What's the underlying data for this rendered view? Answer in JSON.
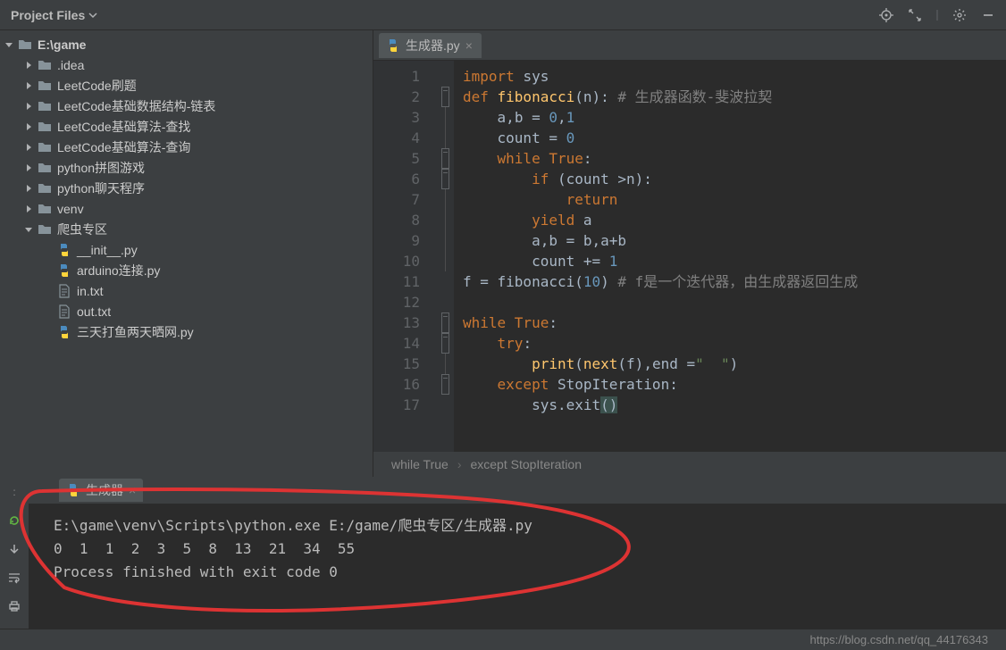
{
  "toolbar": {
    "project_label": "Project Files"
  },
  "project_tree": {
    "root": "E:\\game",
    "items": [
      {
        "type": "folder",
        "label": ".idea",
        "depth": 1,
        "caret": "right"
      },
      {
        "type": "folder",
        "label": "LeetCode刷题",
        "depth": 1,
        "caret": "right"
      },
      {
        "type": "folder",
        "label": "LeetCode基础数据结构-链表",
        "depth": 1,
        "caret": "right"
      },
      {
        "type": "folder",
        "label": "LeetCode基础算法-查找",
        "depth": 1,
        "caret": "right"
      },
      {
        "type": "folder",
        "label": "LeetCode基础算法-查询",
        "depth": 1,
        "caret": "right"
      },
      {
        "type": "folder",
        "label": "python拼图游戏",
        "depth": 1,
        "caret": "right"
      },
      {
        "type": "folder",
        "label": "python聊天程序",
        "depth": 1,
        "caret": "right"
      },
      {
        "type": "folder-alt",
        "label": "venv",
        "depth": 1,
        "caret": "right"
      },
      {
        "type": "folder",
        "label": "爬虫专区",
        "depth": 1,
        "caret": "down"
      },
      {
        "type": "python",
        "label": "__init__.py",
        "depth": 2,
        "caret": "none"
      },
      {
        "type": "python",
        "label": "arduino连接.py",
        "depth": 2,
        "caret": "none"
      },
      {
        "type": "txt",
        "label": "in.txt",
        "depth": 2,
        "caret": "none"
      },
      {
        "type": "txt",
        "label": "out.txt",
        "depth": 2,
        "caret": "none"
      },
      {
        "type": "python",
        "label": "三天打鱼两天晒网.py",
        "depth": 2,
        "caret": "none"
      }
    ]
  },
  "editor": {
    "tab_label": "生成器.py",
    "breadcrumb": [
      "while True",
      "except StopIteration"
    ],
    "lines": [
      {
        "n": 1,
        "fold": "",
        "code": "<span class='kw'>import </span>sys"
      },
      {
        "n": 2,
        "fold": "minus",
        "code": "<span class='kw'>def </span><span class='fn'>fibonacci</span>(n): <span class='cmt'># 生成器函数-斐波拉契</span>"
      },
      {
        "n": 3,
        "fold": "line",
        "code": "    a<span class='op'>,</span>b = <span class='num'>0</span><span class='op'>,</span><span class='num'>1</span>"
      },
      {
        "n": 4,
        "fold": "line",
        "code": "    count = <span class='num'>0</span>"
      },
      {
        "n": 5,
        "fold": "minus",
        "code": "    <span class='kw'>while True</span>:"
      },
      {
        "n": 6,
        "fold": "minus",
        "code": "        <span class='kw'>if </span>(count &gt;n):"
      },
      {
        "n": 7,
        "fold": "line",
        "code": "            <span class='kw'>return</span>"
      },
      {
        "n": 8,
        "fold": "line",
        "code": "        <span class='kw'>yield </span>a"
      },
      {
        "n": 9,
        "fold": "line",
        "code": "        a<span class='op'>,</span>b = b<span class='op'>,</span>a+b"
      },
      {
        "n": 10,
        "fold": "line",
        "code": "        count += <span class='num'>1</span>"
      },
      {
        "n": 11,
        "fold": "",
        "code": "f = fibonacci(<span class='num'>10</span>) <span class='cmt'># f是一个迭代器，由生成器返回生成</span>"
      },
      {
        "n": 12,
        "fold": "",
        "code": ""
      },
      {
        "n": 13,
        "fold": "minus",
        "code": "<span class='kw'>while True</span>:"
      },
      {
        "n": 14,
        "fold": "minus",
        "code": "    <span class='kw'>try</span>:"
      },
      {
        "n": 15,
        "fold": "line",
        "code": "        <span class='fn'>print</span>(<span class='fn'>next</span>(f)<span class='op'>,</span><span class='par'>end</span><span class='op'> =</span><span class='str'>\"  \"</span>)"
      },
      {
        "n": 16,
        "fold": "minus",
        "code": "    <span class='kw'>except </span>StopIteration:"
      },
      {
        "n": 17,
        "fold": "",
        "code": "        sys.exit<span class='yel'>()</span>"
      }
    ]
  },
  "run": {
    "tab_label": "生成器",
    "lines": [
      "E:\\game\\venv\\Scripts\\python.exe E:/game/爬虫专区/生成器.py",
      "0  1  1  2  3  5  8  13  21  34  55",
      "Process finished with exit code 0"
    ]
  },
  "statusbar": {
    "text": "https://blog.csdn.net/qq_44176343"
  },
  "icons": {
    "target": "target",
    "expand": "expand-icon",
    "divider": "divider-icon",
    "gear": "gear-icon",
    "minimize": "minimize-icon"
  }
}
